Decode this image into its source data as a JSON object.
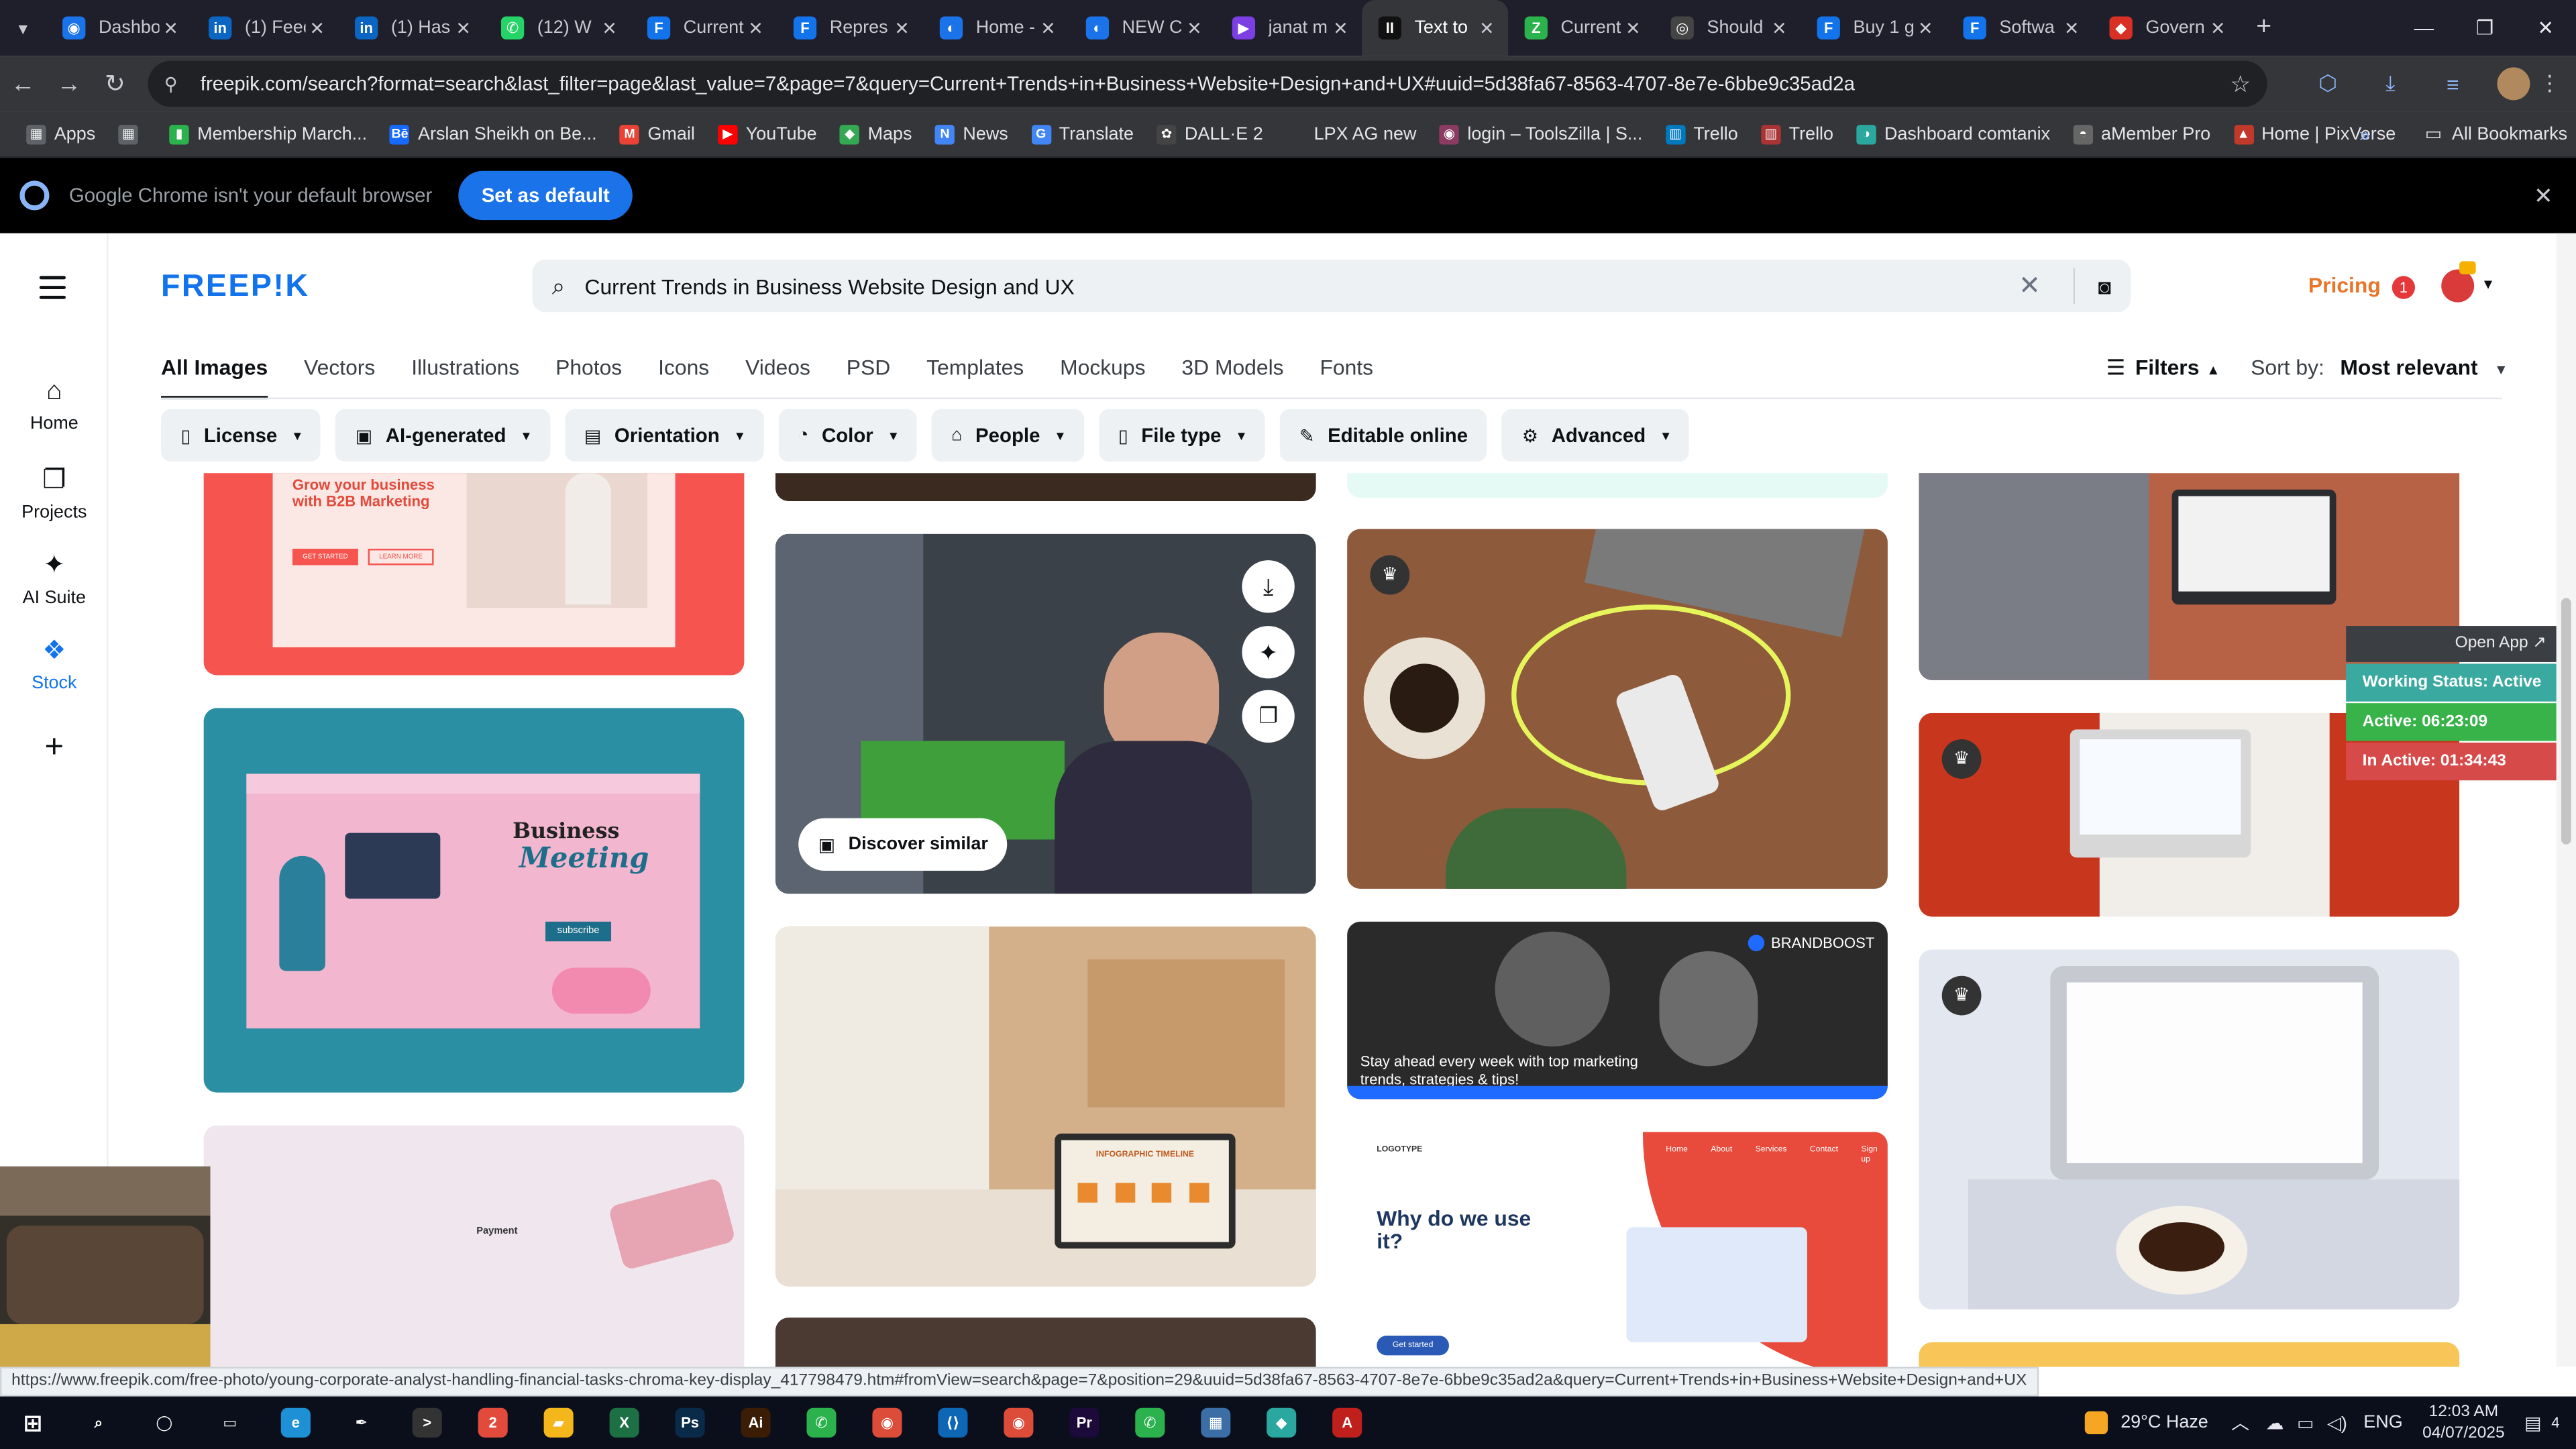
{
  "browser": {
    "tabs": [
      {
        "title": "Dashbo",
        "color": "#1a73e8",
        "glyph": "◉"
      },
      {
        "title": "(1) Feed",
        "color": "#0a66c2",
        "glyph": "in"
      },
      {
        "title": "(1) Has",
        "color": "#0a66c2",
        "glyph": "in"
      },
      {
        "title": "(12) W",
        "color": "#25d366",
        "glyph": "✆"
      },
      {
        "title": "Current",
        "color": "#1273eb",
        "glyph": "F"
      },
      {
        "title": "Repres",
        "color": "#1273eb",
        "glyph": "F"
      },
      {
        "title": "Home -",
        "color": "#1a73e8",
        "glyph": "◐"
      },
      {
        "title": "NEW C",
        "color": "#1a73e8",
        "glyph": "◐"
      },
      {
        "title": "janat m",
        "color": "#7b3fe4",
        "glyph": "▶"
      },
      {
        "title": "Text to",
        "color": "#111111",
        "glyph": "II"
      },
      {
        "title": "Current",
        "color": "#2bb24c",
        "glyph": "Z"
      },
      {
        "title": "Should",
        "color": "#444444",
        "glyph": "◎"
      },
      {
        "title": "Buy 1 g",
        "color": "#1273eb",
        "glyph": "F"
      },
      {
        "title": "Softwa",
        "color": "#1273eb",
        "glyph": "F"
      },
      {
        "title": "Govern",
        "color": "#d93025",
        "glyph": "◆"
      }
    ],
    "active_tab_index": 9,
    "url": "freepik.com/search?format=search&last_filter=page&last_value=7&page=7&query=Current+Trends+in+Business+Website+Design+and+UX#uuid=5d38fa67-8563-4707-8e7e-6bbe9c35ad2a",
    "bookmarks": [
      {
        "label": "Apps",
        "color": "#5f6368",
        "glyph": "▦"
      },
      {
        "label": "",
        "color": "#5f6368",
        "glyph": "▦"
      },
      {
        "label": "Membership March...",
        "color": "#2bb24c",
        "glyph": "▮"
      },
      {
        "label": "Arslan Sheikh on Be...",
        "color": "#1769ff",
        "glyph": "Bē"
      },
      {
        "label": "Gmail",
        "color": "#ea4335",
        "glyph": "M"
      },
      {
        "label": "YouTube",
        "color": "#ff0000",
        "glyph": "▶"
      },
      {
        "label": "Maps",
        "color": "#34a853",
        "glyph": "◆"
      },
      {
        "label": "News",
        "color": "#4285f4",
        "glyph": "N"
      },
      {
        "label": "Translate",
        "color": "#4285f4",
        "glyph": "G"
      },
      {
        "label": "DALL·E 2",
        "color": "#444444",
        "glyph": "✿"
      },
      {
        "label": "LPX AG new",
        "color": "#35363a",
        "glyph": ""
      },
      {
        "label": "login – ToolsZilla | S...",
        "color": "#8b3a62",
        "glyph": "◉"
      },
      {
        "label": "Trello",
        "color": "#0079bf",
        "glyph": "▥"
      },
      {
        "label": "Trello",
        "color": "#a33",
        "glyph": "▥"
      },
      {
        "label": "Dashboard comtanix",
        "color": "#2aa8a0",
        "glyph": "◑"
      },
      {
        "label": "aMember Pro",
        "color": "#666666",
        "glyph": "◓"
      },
      {
        "label": "Home | PixVerse",
        "color": "#c0392b",
        "glyph": "▲"
      }
    ],
    "bookmarks_more": "»",
    "all_bookmarks": "All Bookmarks",
    "infobar_message": "Google Chrome isn't your default browser",
    "infobar_button": "Set as default"
  },
  "freepik": {
    "logo": "FREEP!K",
    "search_query": "Current Trends in Business Website Design and UX",
    "pricing": "Pricing",
    "notifications_count": "1",
    "sidebar": [
      {
        "label": "Home",
        "icon": "home-icon",
        "glyph": "⌂"
      },
      {
        "label": "Projects",
        "icon": "projects-icon",
        "glyph": "❐"
      },
      {
        "label": "AI Suite",
        "icon": "ai-suite-icon",
        "glyph": "✦"
      },
      {
        "label": "Stock",
        "icon": "stock-icon",
        "glyph": "❖"
      },
      {
        "label": "",
        "icon": "add-icon",
        "glyph": "+"
      }
    ],
    "categories": [
      "All Images",
      "Vectors",
      "Illustrations",
      "Photos",
      "Icons",
      "Videos",
      "PSD",
      "Templates",
      "Mockups",
      "3D Models",
      "Fonts"
    ],
    "filters_label": "Filters",
    "sort_label": "Sort by:",
    "sort_value": "Most relevant",
    "chips": [
      {
        "label": "License",
        "glyph": "▯",
        "dropdown": true
      },
      {
        "label": "AI-generated",
        "glyph": "▣",
        "dropdown": true
      },
      {
        "label": "Orientation",
        "glyph": "▤",
        "dropdown": true
      },
      {
        "label": "Color",
        "glyph": "◔",
        "dropdown": true
      },
      {
        "label": "People",
        "glyph": "⌂",
        "dropdown": true
      },
      {
        "label": "File type",
        "glyph": "▯",
        "dropdown": true
      },
      {
        "label": "Editable online",
        "glyph": "✎",
        "dropdown": false
      },
      {
        "label": "Advanced",
        "glyph": "⚙",
        "dropdown": true
      }
    ],
    "cards": {
      "b2b_headline": "Grow your business with B2B Marketing",
      "b2b_btn1": "GET STARTED",
      "b2b_btn2": "LEARN MORE",
      "meeting_title1": "Business",
      "meeting_title2": "Meeting",
      "meeting_btn": "subscribe",
      "payment_label": "Payment",
      "discover_similar": "Discover similar",
      "infographic_label": "INFOGRAPHIC TIMELINE",
      "brandboost_brand": "BRANDBOOST",
      "brandboost_tagline": "Stay ahead every week with top marketing trends, strategies & tips!",
      "why_title": "Why do we use it?",
      "why_btn": "Get started",
      "why_logo": "LOGOTYPE",
      "why_nav": [
        "Home",
        "About",
        "Services",
        "Contact",
        "Sign up"
      ]
    },
    "status_url": "https://www.freepik.com/free-photo/young-corporate-analyst-handling-financial-tasks-chroma-key-display_417798479.htm#fromView=search&page=7&position=29&uuid=5d38fa67-8563-4707-8e7e-6bbe9c35ad2a&query=Current+Trends+in+Business+Website+Design+and+UX"
  },
  "tracker": {
    "open_app": "Open App ↗",
    "working_status": "Working Status: Active",
    "active": "Active: 06:23:09",
    "inactive": "In Active: 01:34:43",
    "colors": {
      "working": "#3aa9a0",
      "active": "#37b34a",
      "inactive": "#d64a4a"
    }
  },
  "taskbar": {
    "weather": "29°C  Haze",
    "language": "ENG",
    "time": "12:03 AM",
    "date": "04/07/2025",
    "notification_badge": "4",
    "apps": [
      {
        "name": "start",
        "color": "#ffffff",
        "glyph": "⊞"
      },
      {
        "name": "search",
        "color": "#0b0f1c",
        "glyph": "⌕"
      },
      {
        "name": "cortana",
        "color": "#0b0f1c",
        "glyph": "◯"
      },
      {
        "name": "task-view",
        "color": "#0b0f1c",
        "glyph": "▭"
      },
      {
        "name": "edge",
        "color": "#1e90d6",
        "glyph": "e"
      },
      {
        "name": "pen",
        "color": "#0b0f1c",
        "glyph": "✒"
      },
      {
        "name": "terminal",
        "color": "#333333",
        "glyph": ">"
      },
      {
        "name": "app-red",
        "color": "#e24a3b",
        "glyph": "2"
      },
      {
        "name": "explorer",
        "color": "#f3b71c",
        "glyph": "▰"
      },
      {
        "name": "excel",
        "color": "#1d7044",
        "glyph": "X"
      },
      {
        "name": "photoshop",
        "color": "#0a2a4a",
        "glyph": "Ps"
      },
      {
        "name": "illustrator",
        "color": "#3b1d05",
        "glyph": "Ai"
      },
      {
        "name": "phone",
        "color": "#2bb24c",
        "glyph": "✆"
      },
      {
        "name": "chrome",
        "color": "#dd4b39",
        "glyph": "◉"
      },
      {
        "name": "vscode",
        "color": "#0e67b5",
        "glyph": "⟨⟩"
      },
      {
        "name": "chrome-active",
        "color": "#dd4b39",
        "glyph": "◉"
      },
      {
        "name": "premiere",
        "color": "#1b0a3a",
        "glyph": "Pr"
      },
      {
        "name": "phone2",
        "color": "#2bb24c",
        "glyph": "✆"
      },
      {
        "name": "calculator",
        "color": "#3a6ea5",
        "glyph": "▦"
      },
      {
        "name": "app-teal",
        "color": "#2aa8a0",
        "glyph": "◆"
      },
      {
        "name": "acrobat",
        "color": "#c0201b",
        "glyph": "A"
      }
    ]
  }
}
